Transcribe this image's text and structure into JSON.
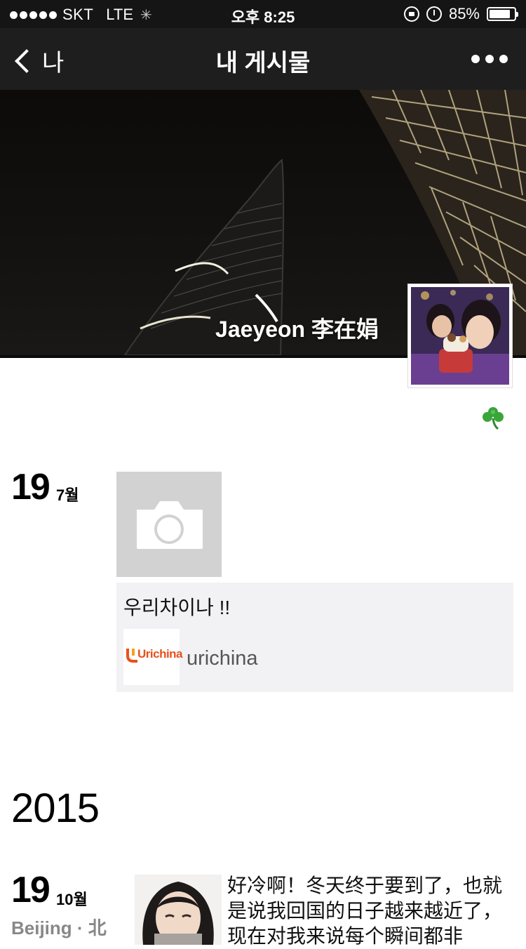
{
  "status_bar": {
    "carrier": "SKT",
    "network": "LTE",
    "time": "오후 8:25",
    "battery_percent": "85%",
    "battery_level": 0.85
  },
  "nav": {
    "back_label": "나",
    "title": "내 게시물"
  },
  "profile": {
    "name": "Jaeyeon 李在娟",
    "signature_icon": "clover"
  },
  "feed": [
    {
      "day": "19",
      "month": "7월",
      "share": {
        "text": "우리차이나 !!",
        "thumb_logo_text": "Urichina",
        "title": "urichina"
      }
    }
  ],
  "year_divider": "2015",
  "feed_2015": [
    {
      "day": "19",
      "month": "10월",
      "location": "Beijing · 北",
      "text": "好冷啊！冬天终于要到了，也就是说我回国的日子越来越近了，现在对我来说每个瞬间都非"
    }
  ]
}
